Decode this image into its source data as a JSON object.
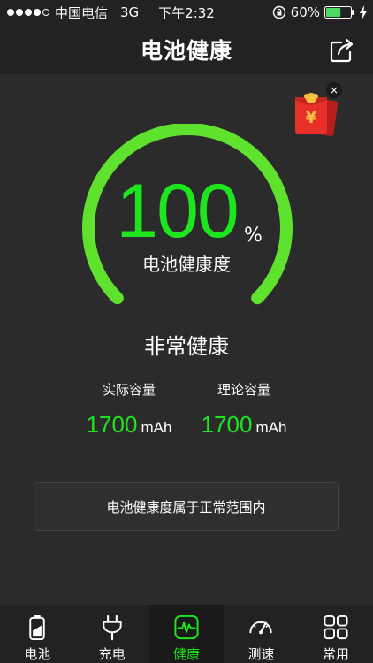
{
  "status_bar": {
    "carrier": "中国电信",
    "network": "3G",
    "time": "下午2:32",
    "battery_percent": "60%",
    "battery_level": 0.6,
    "signal_bars_filled": 4,
    "signal_bars_total": 5
  },
  "header": {
    "title": "电池健康"
  },
  "gauge": {
    "value": "100",
    "percent_sign": "%",
    "label": "电池健康度",
    "fill_fraction": 1.0,
    "color": "#5fe22d"
  },
  "health_status": "非常健康",
  "capacity": {
    "actual_label": "实际容量",
    "actual_value": "1700",
    "actual_unit": "mAh",
    "theory_label": "理论容量",
    "theory_value": "1700",
    "theory_unit": "mAh"
  },
  "notice": "电池健康度属于正常范围内",
  "red_packet": {
    "symbol": "¥",
    "close_symbol": "×"
  },
  "tabs": [
    {
      "label": "电池",
      "icon": "battery-icon",
      "active": false
    },
    {
      "label": "充电",
      "icon": "plug-icon",
      "active": false
    },
    {
      "label": "健康",
      "icon": "pulse-icon",
      "active": true
    },
    {
      "label": "测速",
      "icon": "speedometer-icon",
      "active": false
    },
    {
      "label": "常用",
      "icon": "grid-icon",
      "active": false
    }
  ],
  "colors": {
    "accent": "#1ee61e",
    "background": "#2b2b2b",
    "bar": "#222222",
    "red_packet": "#e8302b"
  }
}
